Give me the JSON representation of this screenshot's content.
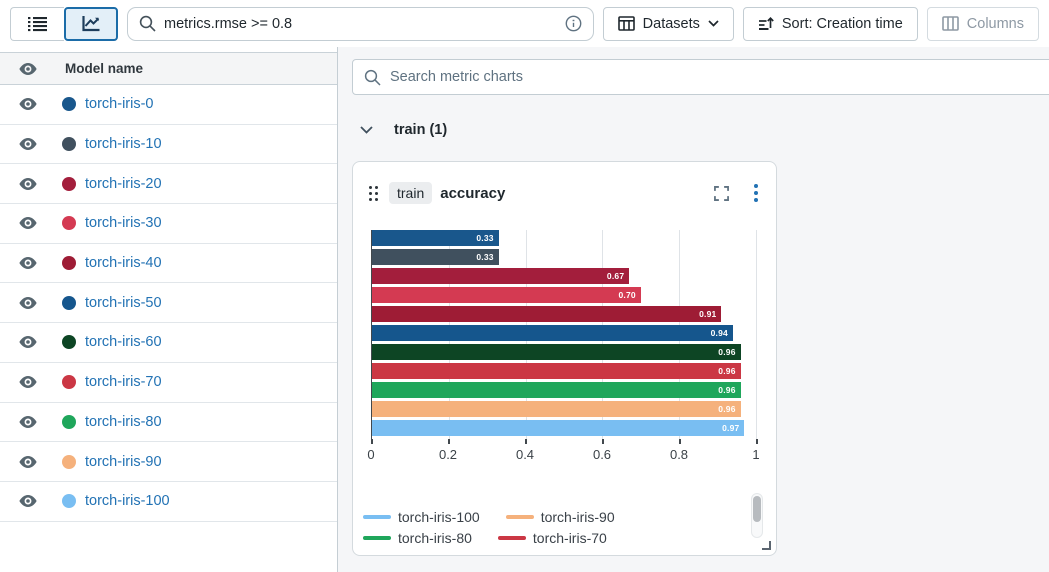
{
  "toolbar": {
    "search": {
      "value": "metrics.rmse >= 0.8"
    },
    "buttons": {
      "datasets": "Datasets",
      "sort": "Sort: Creation time",
      "columns": "Columns"
    }
  },
  "sidebar": {
    "column_header": "Model name",
    "runs": [
      {
        "name": "torch-iris-0",
        "color": "#19578c"
      },
      {
        "name": "torch-iris-10",
        "color": "#40505e"
      },
      {
        "name": "torch-iris-20",
        "color": "#a31e3c"
      },
      {
        "name": "torch-iris-30",
        "color": "#d43a52"
      },
      {
        "name": "torch-iris-40",
        "color": "#9e1c35"
      },
      {
        "name": "torch-iris-50",
        "color": "#15568d"
      },
      {
        "name": "torch-iris-60",
        "color": "#0d4524"
      },
      {
        "name": "torch-iris-70",
        "color": "#cb3744"
      },
      {
        "name": "torch-iris-80",
        "color": "#1fa65b"
      },
      {
        "name": "torch-iris-90",
        "color": "#f5b17c"
      },
      {
        "name": "torch-iris-100",
        "color": "#79bef2"
      }
    ]
  },
  "charts_panel": {
    "search_placeholder": "Search metric charts",
    "section": {
      "label": "train (1)"
    },
    "card": {
      "tag": "train",
      "title": "accuracy"
    }
  },
  "chart_data": {
    "type": "bar",
    "orientation": "horizontal",
    "title": "train accuracy",
    "categories": [
      "torch-iris-0",
      "torch-iris-10",
      "torch-iris-20",
      "torch-iris-30",
      "torch-iris-40",
      "torch-iris-50",
      "torch-iris-60",
      "torch-iris-70",
      "torch-iris-80",
      "torch-iris-90",
      "torch-iris-100"
    ],
    "values": [
      0.33,
      0.33,
      0.67,
      0.7,
      0.91,
      0.94,
      0.96,
      0.96,
      0.96,
      0.96,
      0.97
    ],
    "value_labels": [
      "0.33",
      "0.33",
      "0.67",
      "0.70",
      "0.91",
      "0.94",
      "0.96",
      "0.96",
      "0.96",
      "0.96",
      "0.97"
    ],
    "bar_colors": [
      "#19578c",
      "#40505e",
      "#a31e3c",
      "#d43a52",
      "#9e1c35",
      "#15568d",
      "#0d4524",
      "#cb3744",
      "#1fa65b",
      "#f5b17c",
      "#79bef2"
    ],
    "xlim": [
      0,
      1
    ],
    "x_tick_values": [
      0,
      0.2,
      0.4,
      0.6,
      0.8,
      1
    ],
    "x_tick_labels": [
      "0",
      "0.2",
      "0.4",
      "0.6",
      "0.8",
      "1"
    ],
    "grid": true,
    "xlabel": "",
    "ylabel": "",
    "legend_position": "bottom",
    "legend": [
      {
        "name": "torch-iris-100",
        "color": "#79bef2"
      },
      {
        "name": "torch-iris-90",
        "color": "#f5b17c"
      },
      {
        "name": "torch-iris-80",
        "color": "#1fa65b"
      },
      {
        "name": "torch-iris-70",
        "color": "#cb3744"
      }
    ]
  }
}
